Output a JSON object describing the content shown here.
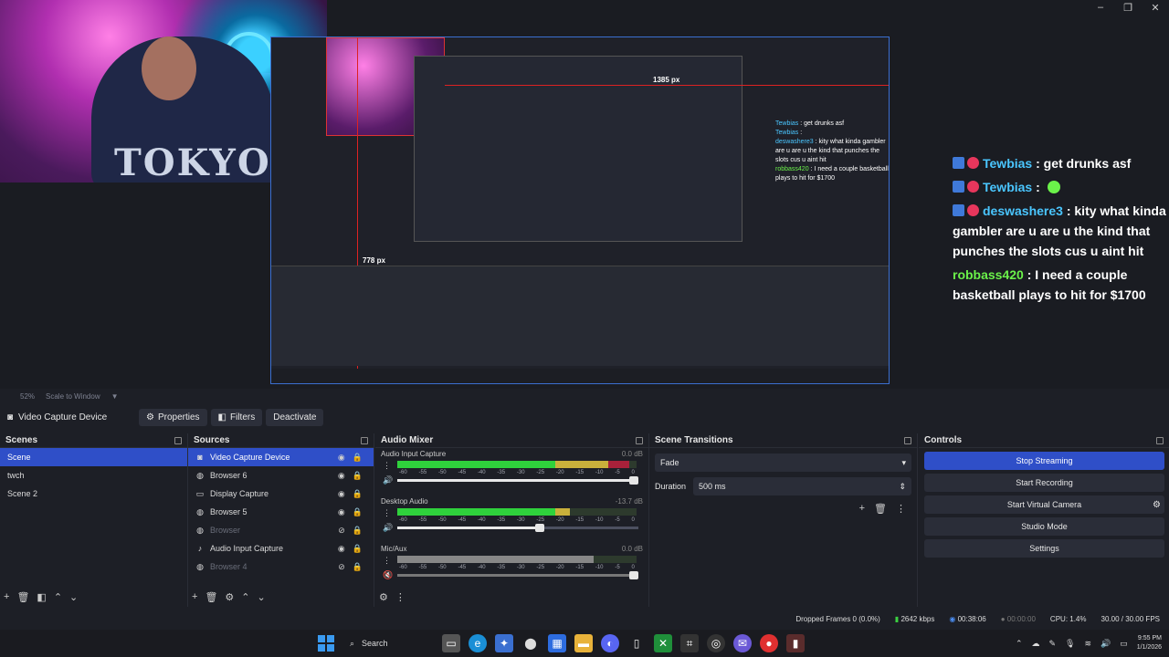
{
  "window_controls": [
    "–",
    "❐",
    "✕"
  ],
  "preview": {
    "px_label_horizontal": "1385 px",
    "px_label_vertical": "778 px",
    "shirt_text": "TOKYO",
    "mini_chat": [
      {
        "user": "Tewbias",
        "text": ": get drunks asf"
      },
      {
        "user": "Tewbias",
        "text": ":"
      },
      {
        "user": "deswashere3",
        "text": ": kity what kinda gambler are u are u the kind that punches the slots cus u aint hit"
      },
      {
        "user": "robbass420",
        "text": ": I need a couple basketball plays to hit for $1700"
      }
    ]
  },
  "chat": [
    {
      "user": "Tewbias",
      "text": " : get drunks asf",
      "color": "#4ac6ff",
      "badges": true
    },
    {
      "user": "Tewbias",
      "text": " : ",
      "color": "#4ac6ff",
      "badges": true,
      "emote": true
    },
    {
      "user": "deswashere3",
      "text": " : kity what kinda gambler are u are u the kind that punches the slots cus u aint hit",
      "color": "#4ac6ff",
      "badges": true
    },
    {
      "user": "robbass420",
      "text": " : I need a couple basketball plays to hit for $1700",
      "color": "#6bf24a",
      "badges": false
    }
  ],
  "zoom_bar": {
    "zoom": "52%",
    "scale_mode": "Scale to Window"
  },
  "source_toolbar": {
    "selected_source": "Video Capture Device",
    "properties": "Properties",
    "filters": "Filters",
    "deactivate": "Deactivate"
  },
  "scenes": {
    "title": "Scenes",
    "items": [
      "Scene",
      "twch",
      "Scene 2"
    ],
    "selected_index": 0
  },
  "sources": {
    "title": "Sources",
    "items": [
      {
        "label": "Video Capture Device",
        "icon": "camera-icon",
        "selected": true,
        "visible": true
      },
      {
        "label": "Browser 6",
        "icon": "globe-icon",
        "selected": false,
        "visible": true
      },
      {
        "label": "Display Capture",
        "icon": "monitor-icon",
        "selected": false,
        "visible": true
      },
      {
        "label": "Browser 5",
        "icon": "globe-icon",
        "selected": false,
        "visible": true
      },
      {
        "label": "Browser",
        "icon": "globe-icon",
        "selected": false,
        "visible": false
      },
      {
        "label": "Audio Input Capture",
        "icon": "mic-icon",
        "selected": false,
        "visible": true
      },
      {
        "label": "Browser 4",
        "icon": "globe-icon",
        "selected": false,
        "visible": false
      }
    ]
  },
  "mixer": {
    "title": "Audio Mixer",
    "ticks": [
      "-60",
      "-55",
      "-50",
      "-45",
      "-40",
      "-35",
      "-30",
      "-25",
      "-20",
      "-15",
      "-10",
      "-5",
      "0"
    ],
    "channels": [
      {
        "name": "Audio Input Capture",
        "db": "0.0 dB",
        "level": 0.97,
        "volume": 1.0,
        "muted": false
      },
      {
        "name": "Desktop Audio",
        "db": "-13.7 dB",
        "level": 0.72,
        "volume": 0.61,
        "muted": false
      },
      {
        "name": "Mic/Aux",
        "db": "0.0 dB",
        "level": 0.82,
        "volume": 1.0,
        "muted": true
      }
    ]
  },
  "transitions": {
    "title": "Scene Transitions",
    "selected": "Fade",
    "duration_label": "Duration",
    "duration_value": "500 ms"
  },
  "controls": {
    "title": "Controls",
    "stop_streaming": "Stop Streaming",
    "start_recording": "Start Recording",
    "start_virtual_camera": "Start Virtual Camera",
    "studio_mode": "Studio Mode",
    "settings": "Settings"
  },
  "status": {
    "dropped_frames": "Dropped Frames 0 (0.0%)",
    "bitrate": "2642 kbps",
    "stream_time": "00:38:06",
    "record_time": "00:00:00",
    "cpu": "CPU: 1.4%",
    "fps": "30.00 / 30.00 FPS"
  },
  "taskbar": {
    "search_label": "Search",
    "time": "9:55 PM",
    "date": "1/1/2026"
  }
}
